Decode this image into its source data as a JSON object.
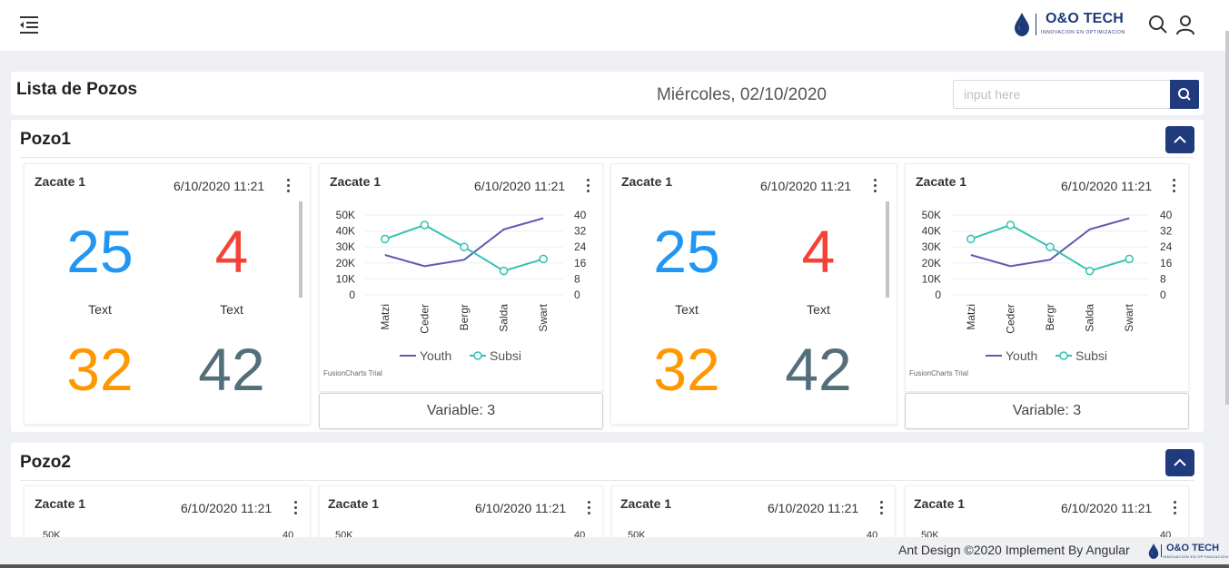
{
  "header": {
    "brand_name": "O&O TECH",
    "brand_tagline": "INNOVACION EN OPTIMIZACION",
    "brand_color": "#1d3a78"
  },
  "page": {
    "title": "Lista de Pozos",
    "date": "Miércoles, 02/10/2020",
    "search_placeholder": "input here"
  },
  "colors": {
    "blue": "#2196f3",
    "red": "#f44336",
    "orange": "#ff9800",
    "slate": "#546e7a",
    "youth": "#5e5bb1",
    "subsi": "#32c2b3"
  },
  "pozos": [
    {
      "title": "Pozo1",
      "cards": [
        {
          "kind": "kpi",
          "title": "Zacate 1",
          "time": "6/10/2020 11:21",
          "values": [
            "25",
            "4",
            "32",
            "42"
          ],
          "labels": [
            "Text",
            "Text"
          ]
        },
        {
          "kind": "chart",
          "title": "Zacate 1",
          "time": "6/10/2020 11:21",
          "trial": "FusionCharts Trial",
          "variable": "Variable: 3"
        },
        {
          "kind": "kpi",
          "title": "Zacate 1",
          "time": "6/10/2020 11:21",
          "values": [
            "25",
            "4",
            "32",
            "42"
          ],
          "labels": [
            "Text",
            "Text"
          ]
        },
        {
          "kind": "chart",
          "title": "Zacate 1",
          "time": "6/10/2020 11:21",
          "trial": "FusionCharts Trial",
          "variable": "Variable: 3"
        }
      ]
    },
    {
      "title": "Pozo2",
      "cards": [
        {
          "title": "Zacate 1",
          "time": "6/10/2020 11:21",
          "left_tick": "50K",
          "right_tick": "40"
        },
        {
          "title": "Zacate 1",
          "time": "6/10/2020 11:21",
          "left_tick": "50K",
          "right_tick": "40"
        },
        {
          "title": "Zacate 1",
          "time": "6/10/2020 11:21",
          "left_tick": "50K",
          "right_tick": "40"
        },
        {
          "title": "Zacate 1",
          "time": "6/10/2020 11:21",
          "left_tick": "50K",
          "right_tick": "40"
        }
      ]
    }
  ],
  "chart_data": {
    "type": "line",
    "categories": [
      "Matzi",
      "Ceder",
      "Bergr",
      "Salda",
      "Swart"
    ],
    "series": [
      {
        "name": "Youth",
        "axis": "left",
        "values": [
          25000,
          18000,
          22000,
          41000,
          48000
        ]
      },
      {
        "name": "Subsi",
        "axis": "right",
        "values": [
          28,
          35,
          24,
          12,
          18
        ]
      }
    ],
    "y_left": {
      "min": 0,
      "max": 50000,
      "ticks": [
        "0",
        "10K",
        "20K",
        "30K",
        "40K",
        "50K"
      ]
    },
    "y_right": {
      "min": 0,
      "max": 40,
      "ticks": [
        "0",
        "8",
        "16",
        "24",
        "32",
        "40"
      ]
    },
    "legend": "bottom",
    "grid": true
  },
  "footer": {
    "text": "Ant Design ©2020 Implement By Angular",
    "brand_name": "O&O TECH",
    "brand_tagline": "INNOVACION EN OPTIMIZACION"
  }
}
